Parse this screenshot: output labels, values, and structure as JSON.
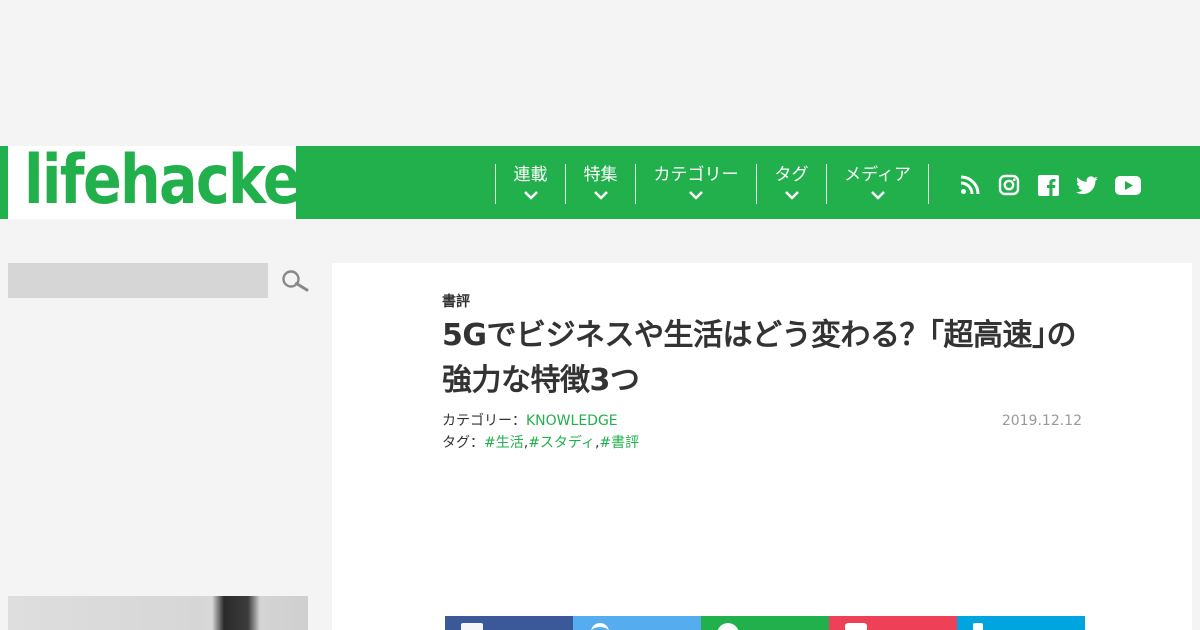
{
  "header": {
    "logo_text": "lifehacker",
    "brand_color": "#21b04b"
  },
  "nav": {
    "items": [
      {
        "label": "連載"
      },
      {
        "label": "特集"
      },
      {
        "label": "カテゴリー"
      },
      {
        "label": "タグ"
      },
      {
        "label": "メディア"
      }
    ],
    "social_icons": [
      "rss-icon",
      "instagram-icon",
      "facebook-icon",
      "twitter-icon",
      "youtube-icon"
    ]
  },
  "sidebar": {
    "search": {
      "placeholder": "",
      "value": ""
    }
  },
  "article": {
    "category_label": "書評",
    "title": "5Gでビジネスや生活はどう変わる？｢超高速｣の強力な特徴3つ",
    "category_prefix": "カテゴリー：",
    "category_link": "KNOWLEDGE",
    "tags_prefix": "タグ：",
    "tags": [
      "#生活",
      "#スタディ",
      "#書評"
    ],
    "tag_separator": ",",
    "date": "2019.12.12"
  },
  "share": {
    "buttons": [
      {
        "name": "facebook",
        "color": "#3b5998"
      },
      {
        "name": "twitter",
        "color": "#55acee"
      },
      {
        "name": "line",
        "color": "#21b04b"
      },
      {
        "name": "pocket",
        "color": "#ee4056"
      },
      {
        "name": "hatena",
        "color": "#00a4de"
      }
    ]
  }
}
